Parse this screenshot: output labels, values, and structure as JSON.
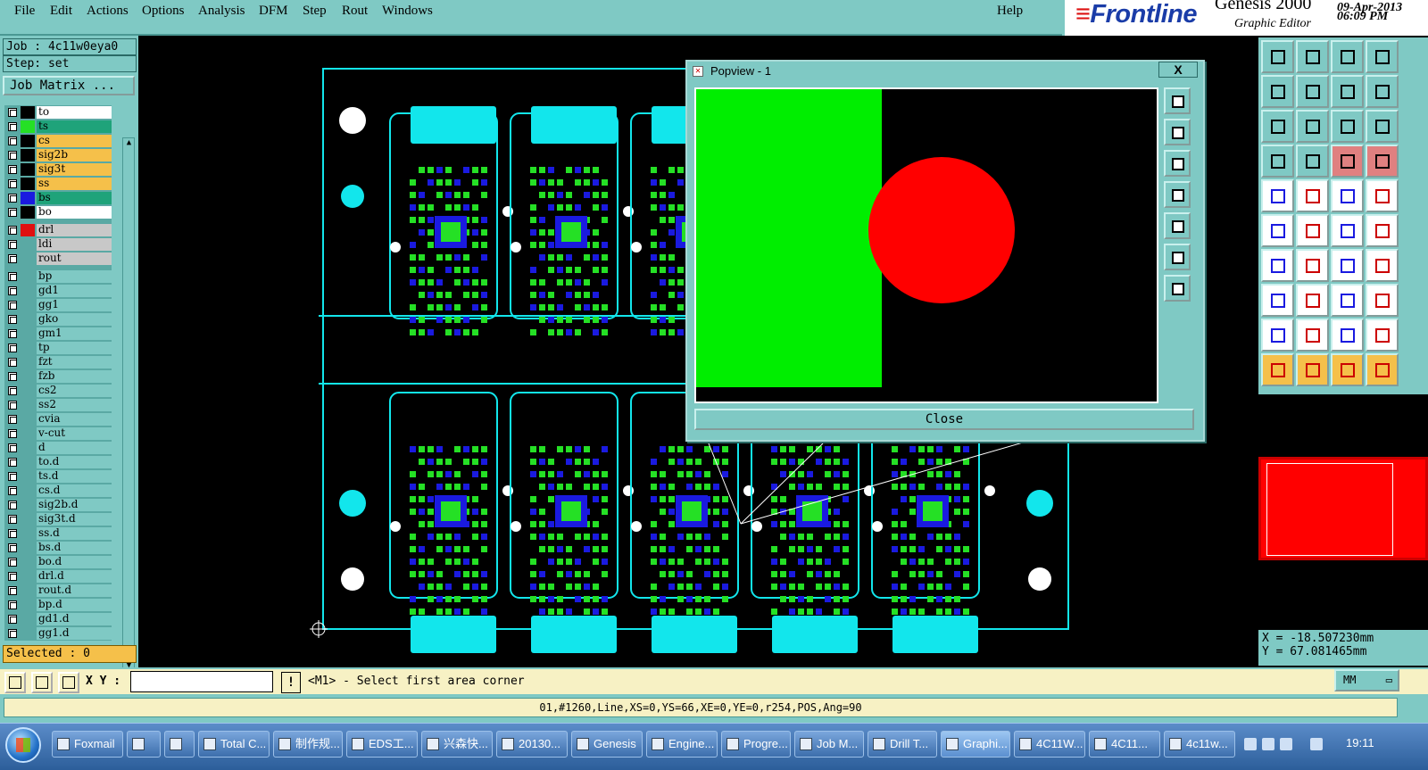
{
  "menu": {
    "items": [
      "File",
      "Edit",
      "Actions",
      "Options",
      "Analysis",
      "DFM",
      "Step",
      "Rout",
      "Windows"
    ],
    "help": "Help"
  },
  "brand": {
    "logo": "Frontline",
    "product": "Genesis 2000",
    "subtitle": "Graphic Editor",
    "date": "09-Apr-2013",
    "time": "06:09 PM"
  },
  "job": {
    "job_label": "Job : 4c11w0eya0",
    "step_label": "Step: set",
    "matrix_button": "Job Matrix ..."
  },
  "layers": [
    {
      "name": "to",
      "color": "#ffffff",
      "swatch": "#000000"
    },
    {
      "name": "ts",
      "color": "#1fa37a",
      "swatch": "#25e025"
    },
    {
      "name": "cs",
      "color": "#f5c04a",
      "swatch": "#000000"
    },
    {
      "name": "sig2b",
      "color": "#f5c04a",
      "swatch": "#000000"
    },
    {
      "name": "sig3t",
      "color": "#f5c04a",
      "swatch": "#000000"
    },
    {
      "name": "ss",
      "color": "#f5c04a",
      "swatch": "#000000"
    },
    {
      "name": "bs",
      "color": "#1fa37a",
      "swatch": "#1a1ae0"
    },
    {
      "name": "bo",
      "color": "#ffffff",
      "swatch": "#000000"
    },
    {
      "name": "drl",
      "color": "#c8c8c8",
      "swatch": "#e01010"
    },
    {
      "name": "ldi",
      "color": "#c8c8c8",
      "swatch": "#5aa9a4"
    },
    {
      "name": "rout",
      "color": "#c8c8c8",
      "swatch": "#5aa9a4"
    },
    {
      "name": "bp",
      "color": "#7fc9c4",
      "swatch": "#5aa9a4"
    },
    {
      "name": "gd1",
      "color": "#7fc9c4",
      "swatch": "#5aa9a4"
    },
    {
      "name": "gg1",
      "color": "#7fc9c4",
      "swatch": "#5aa9a4"
    },
    {
      "name": "gko",
      "color": "#7fc9c4",
      "swatch": "#5aa9a4"
    },
    {
      "name": "gm1",
      "color": "#7fc9c4",
      "swatch": "#5aa9a4"
    },
    {
      "name": "tp",
      "color": "#7fc9c4",
      "swatch": "#5aa9a4"
    },
    {
      "name": "fzt",
      "color": "#7fc9c4",
      "swatch": "#5aa9a4"
    },
    {
      "name": "fzb",
      "color": "#7fc9c4",
      "swatch": "#5aa9a4"
    },
    {
      "name": "cs2",
      "color": "#7fc9c4",
      "swatch": "#5aa9a4"
    },
    {
      "name": "ss2",
      "color": "#7fc9c4",
      "swatch": "#5aa9a4"
    },
    {
      "name": "cvia",
      "color": "#7fc9c4",
      "swatch": "#5aa9a4"
    },
    {
      "name": "v-cut",
      "color": "#7fc9c4",
      "swatch": "#5aa9a4"
    },
    {
      "name": "d",
      "color": "#7fc9c4",
      "swatch": "#5aa9a4"
    },
    {
      "name": "to.d",
      "color": "#7fc9c4",
      "swatch": "#5aa9a4"
    },
    {
      "name": "ts.d",
      "color": "#7fc9c4",
      "swatch": "#5aa9a4"
    },
    {
      "name": "cs.d",
      "color": "#7fc9c4",
      "swatch": "#5aa9a4"
    },
    {
      "name": "sig2b.d",
      "color": "#7fc9c4",
      "swatch": "#5aa9a4"
    },
    {
      "name": "sig3t.d",
      "color": "#7fc9c4",
      "swatch": "#5aa9a4"
    },
    {
      "name": "ss.d",
      "color": "#7fc9c4",
      "swatch": "#5aa9a4"
    },
    {
      "name": "bs.d",
      "color": "#7fc9c4",
      "swatch": "#5aa9a4"
    },
    {
      "name": "bo.d",
      "color": "#7fc9c4",
      "swatch": "#5aa9a4"
    },
    {
      "name": "drl.d",
      "color": "#7fc9c4",
      "swatch": "#5aa9a4"
    },
    {
      "name": "rout.d",
      "color": "#7fc9c4",
      "swatch": "#5aa9a4"
    },
    {
      "name": "bp.d",
      "color": "#7fc9c4",
      "swatch": "#5aa9a4"
    },
    {
      "name": "gd1.d",
      "color": "#7fc9c4",
      "swatch": "#5aa9a4"
    },
    {
      "name": "gg1.d",
      "color": "#7fc9c4",
      "swatch": "#5aa9a4"
    }
  ],
  "selected_label": "Selected : 0",
  "popview": {
    "title": "Popview - 1",
    "close_x": "X",
    "close_button": "Close"
  },
  "coords": {
    "x": "X = -18.507230mm",
    "y": "Y = 67.081465mm"
  },
  "units_button": "MM",
  "command": {
    "xy_label": "X Y :",
    "warn": "!",
    "prompt": "<M1> - Select first area corner"
  },
  "status_line": "01,#1260,Line,XS=0,YS=66,XE=0,YE=0,r254,POS,Ang=90",
  "taskbar": {
    "tasks": [
      "Foxmail",
      "",
      "",
      "Total C...",
      "制作规...",
      "EDS工...",
      "兴森快...",
      "20130...",
      "Genesis",
      "Engine...",
      "Progre...",
      "Job M...",
      "Drill T...",
      "Graphi...",
      "4C11W...",
      "4C11...",
      "4c11w..."
    ],
    "clock": "19:11"
  },
  "colors": {
    "panel": "#7fc9c4",
    "cyan_layer": "#12e6ec",
    "green_layer": "#25e025",
    "blue_layer": "#1a1ae0",
    "drill_red": "#ff0000"
  }
}
